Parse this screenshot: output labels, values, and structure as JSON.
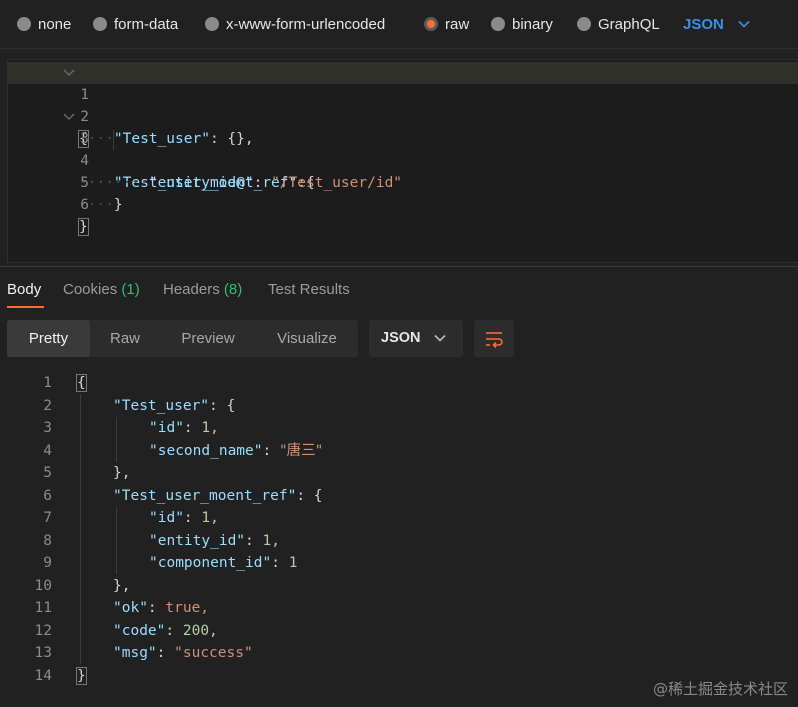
{
  "body_types": {
    "options": [
      "none",
      "form-data",
      "x-www-form-urlencoded",
      "raw",
      "binary",
      "GraphQL"
    ],
    "selected": "raw",
    "language": "JSON"
  },
  "request_editor": {
    "lines": [
      {
        "num": "1"
      },
      {
        "num": "2"
      },
      {
        "num": "3"
      },
      {
        "num": "4"
      },
      {
        "num": "5"
      },
      {
        "num": "6"
      }
    ],
    "tokens": {
      "l1_open": "{",
      "l2_key": "\"Test_user\"",
      "l2_rest": ": {},",
      "l3_key": "\"Test_user_moent_ref\"",
      "l3_rest": ":{",
      "l4_key": "\"entity_id@\"",
      "l4_colon": ": ",
      "l4_val": "\"/Test_user/id\"",
      "l5_close": "}",
      "l6_close": "}"
    }
  },
  "response_tabs": {
    "body": "Body",
    "cookies": "Cookies",
    "cookies_count": "(1)",
    "headers": "Headers",
    "headers_count": "(8)",
    "test_results": "Test Results"
  },
  "view_modes": {
    "pretty": "Pretty",
    "raw": "Raw",
    "preview": "Preview",
    "visualize": "Visualize",
    "format": "JSON"
  },
  "response_editor": {
    "nums": [
      "1",
      "2",
      "3",
      "4",
      "5",
      "6",
      "7",
      "8",
      "9",
      "10",
      "11",
      "12",
      "13",
      "14"
    ],
    "t": {
      "open": "{",
      "test_user_key": "\"Test_user\"",
      "colon_brace": ": {",
      "id_key": "\"id\"",
      "one_comma": "1,",
      "second_name_key": "\"second_name\"",
      "second_name_val": "\"唐三\"",
      "close_comma": "},",
      "moent_ref_key": "\"Test_user_moent_ref\"",
      "entity_id_key": "\"entity_id\"",
      "component_id_key": "\"component_id\"",
      "one": "1",
      "ok_key": "\"ok\"",
      "true_val": "true,",
      "code_key": "\"code\"",
      "code_val": "200,",
      "msg_key": "\"msg\"",
      "msg_val": "\"success\"",
      "close": "}",
      "colon": ": "
    }
  },
  "watermark": "@稀土掘金技术社区",
  "colors": {
    "accent": "#ff6c37",
    "link_blue": "#3b8eea",
    "count_green": "#2fbf71"
  }
}
